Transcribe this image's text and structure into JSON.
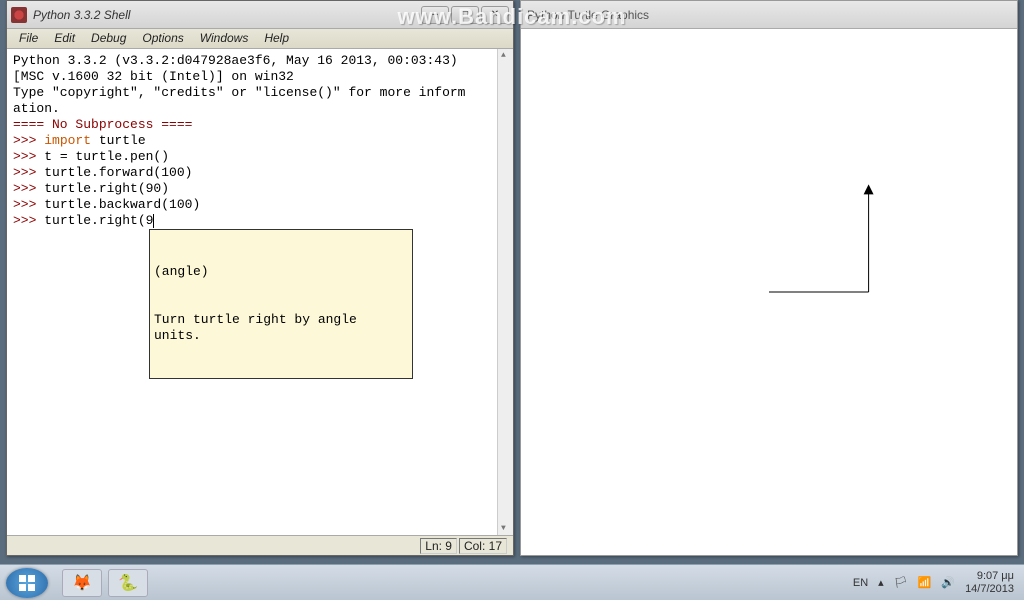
{
  "watermark": "www.Bandicam.com",
  "shellWindow": {
    "title": "Python 3.3.2 Shell",
    "menu": [
      "File",
      "Edit",
      "Debug",
      "Options",
      "Windows",
      "Help"
    ],
    "banner_l1": "Python 3.3.2 (v3.3.2:d047928ae3f6, May 16 2013, 00:03:43)",
    "banner_l2": "[MSC v.1600 32 bit (Intel)] on win32",
    "banner_l3": "Type \"copyright\", \"credits\" or \"license()\" for more inform",
    "banner_l4": "ation.",
    "sep": "==== No Subprocess ====",
    "lines": [
      {
        "prompt": ">>>",
        "kw": "import",
        "rest": " turtle"
      },
      {
        "prompt": ">>>",
        "kw": "",
        "rest": "t = turtle.pen()"
      },
      {
        "prompt": ">>>",
        "kw": "",
        "rest": "turtle.forward(100)"
      },
      {
        "prompt": ">>>",
        "kw": "",
        "rest": "turtle.right(90)"
      },
      {
        "prompt": ">>>",
        "kw": "",
        "rest": "turtle.backward(100)"
      },
      {
        "prompt": ">>>",
        "kw": "",
        "rest": "turtle.right(9"
      }
    ],
    "tooltip_l1": "(angle)",
    "tooltip_l2": "Turn turtle right by angle units.",
    "status_ln": "Ln: 9",
    "status_col": "Col: 17"
  },
  "turtleWindow": {
    "title": "Python Turtle Graphics"
  },
  "taskbar": {
    "lang": "EN",
    "time": "9:07 μμ",
    "date": "14/7/2013"
  }
}
